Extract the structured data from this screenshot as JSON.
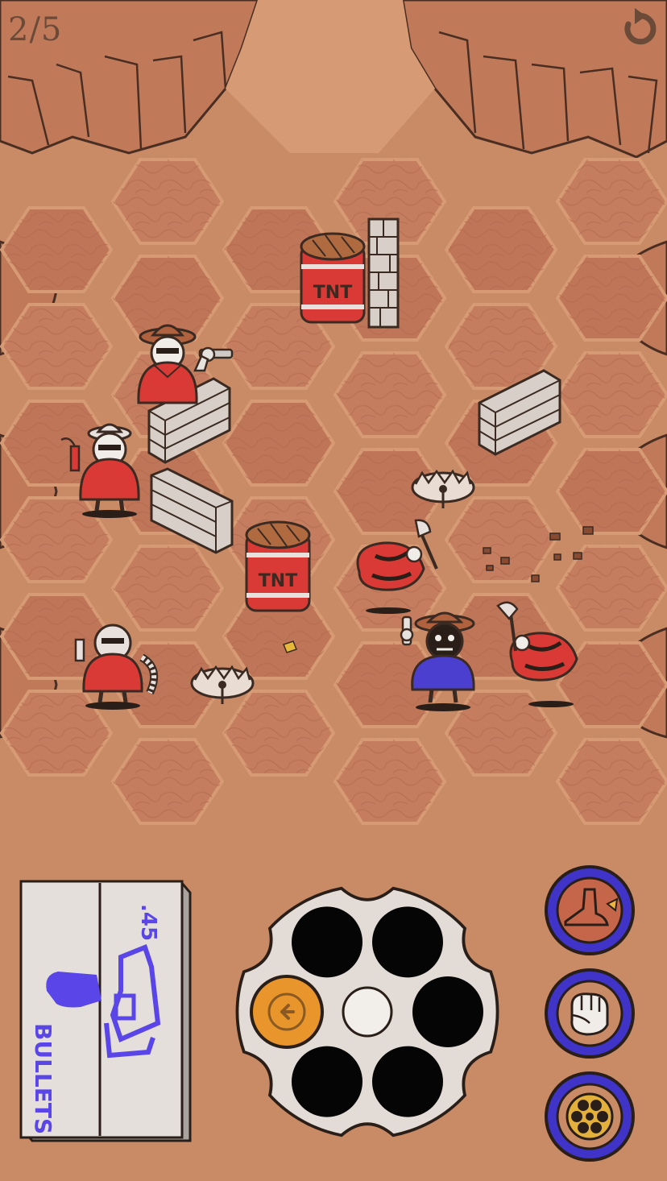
{
  "hud": {
    "level_label": "2/5",
    "undo_icon": "undo-arrow-icon"
  },
  "board": {
    "tiles": "hexagonal",
    "obstacles": [
      "tnt-barrel",
      "tnt-barrel",
      "brick-wall",
      "brick-wall",
      "brick-wall",
      "brick-wall",
      "bear-trap",
      "bear-trap"
    ],
    "barrel_label": "TNT",
    "player": "cowboy-blue-poncho",
    "enemies": [
      "bandit-revolver",
      "bandit-dynamite",
      "bandit-gatling",
      "bandit-axe-fallen",
      "bandit-axe-fallen"
    ]
  },
  "ammo_box": {
    "caliber": ".45",
    "label": "BULLETS"
  },
  "cylinder": {
    "chambers_loaded": 5,
    "chamber_total": 6,
    "selected_chamber_icon": "arrow-left-icon"
  },
  "actions": [
    {
      "name": "kick-button",
      "icon": "boot-kick-icon"
    },
    {
      "name": "punch-button",
      "icon": "fist-icon"
    },
    {
      "name": "reload-button",
      "icon": "revolver-cylinder-icon"
    }
  ],
  "colors": {
    "ground": "#c98a66",
    "hex_tile": "#c2795b",
    "bandit_red": "#d93a35",
    "player_blue": "#4b3fd0",
    "action_ring": "#3f34c7",
    "ammo_ink": "#5a45e8",
    "chamber_selected": "#e8952c"
  }
}
